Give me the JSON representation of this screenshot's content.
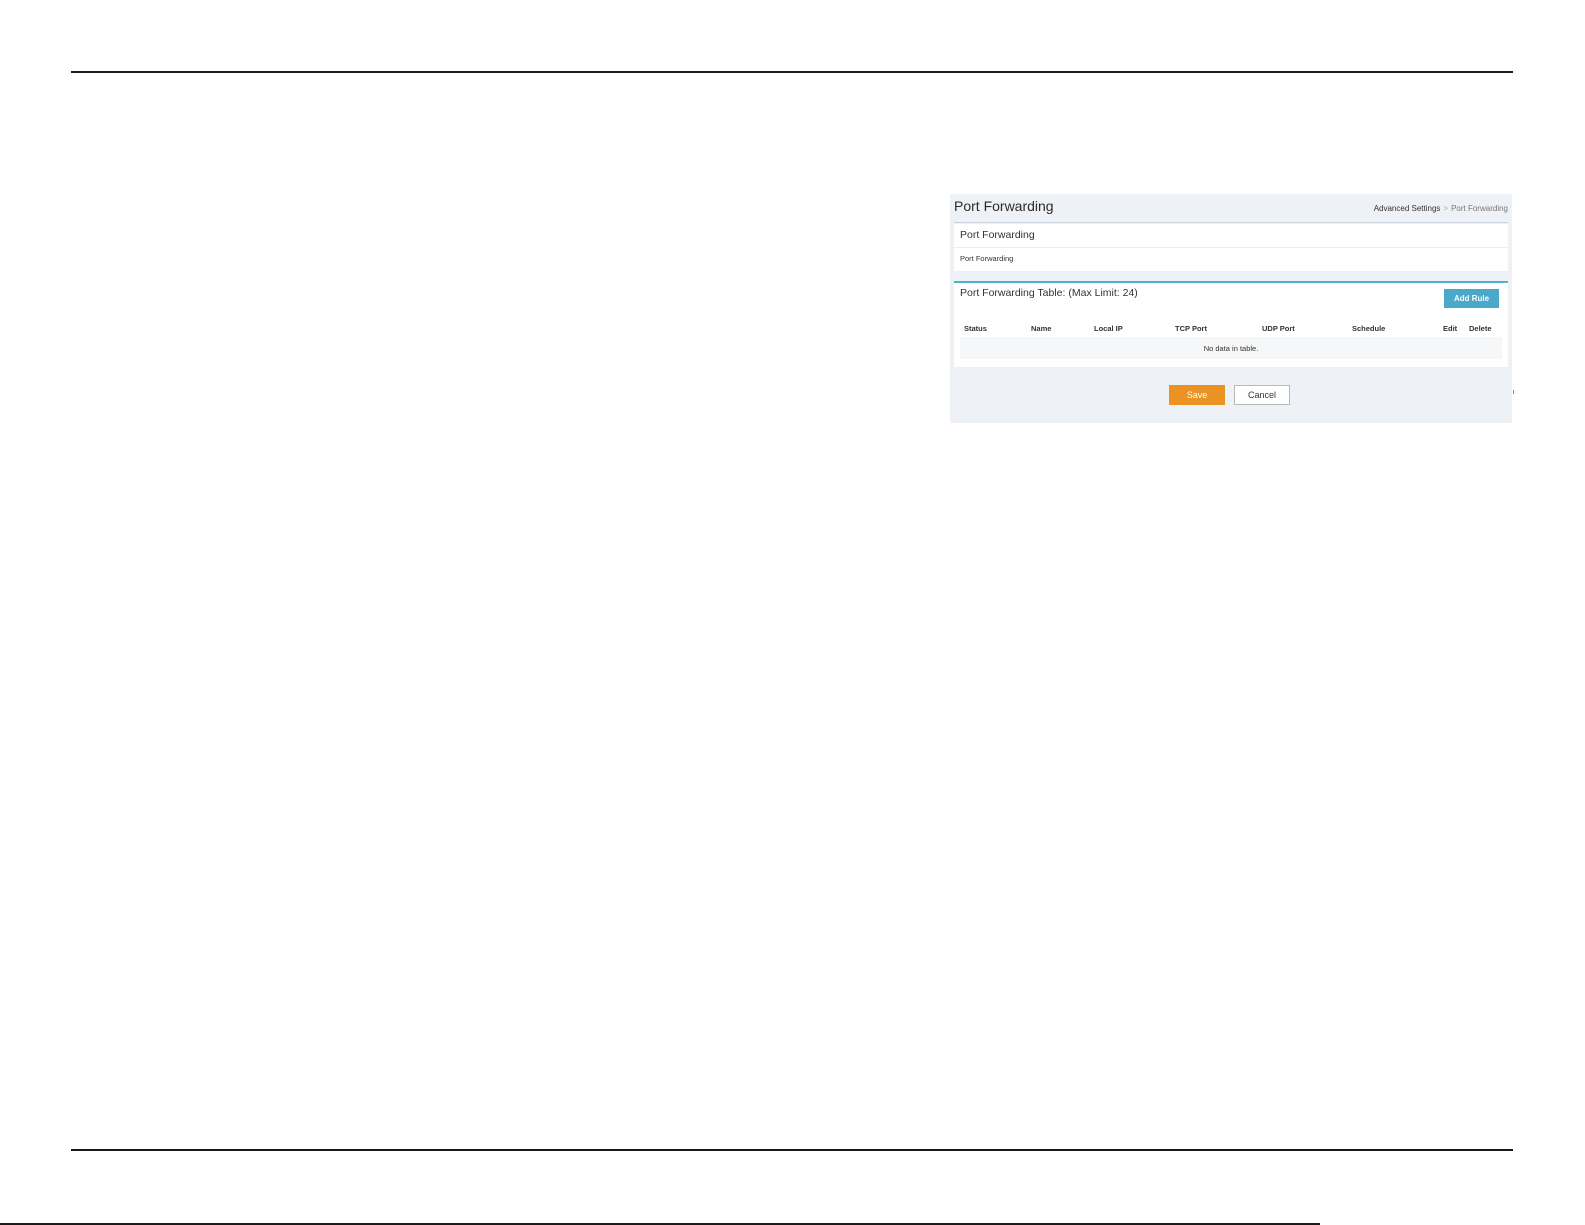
{
  "header": {
    "title": "Port Forwarding",
    "breadcrumb": [
      "Advanced Settings",
      "Port Forwarding"
    ],
    "breadcrumb_separator": ">"
  },
  "section": {
    "title": "Port Forwarding",
    "subtitle": "Port Forwarding"
  },
  "table": {
    "title": "Port Forwarding Table: (Max Limit: 24)",
    "add_button_label": "Add Rule",
    "columns": [
      "Status",
      "Name",
      "Local IP",
      "TCP Port",
      "UDP Port",
      "Schedule",
      "Edit",
      "Delete"
    ],
    "rows": [],
    "empty_message": "No data in table."
  },
  "actions": {
    "save_label": "Save",
    "cancel_label": "Cancel"
  },
  "colors": {
    "accent_blue": "#4aa8c8",
    "save_orange": "#ea9323",
    "panel_background": "#eef1f5"
  }
}
